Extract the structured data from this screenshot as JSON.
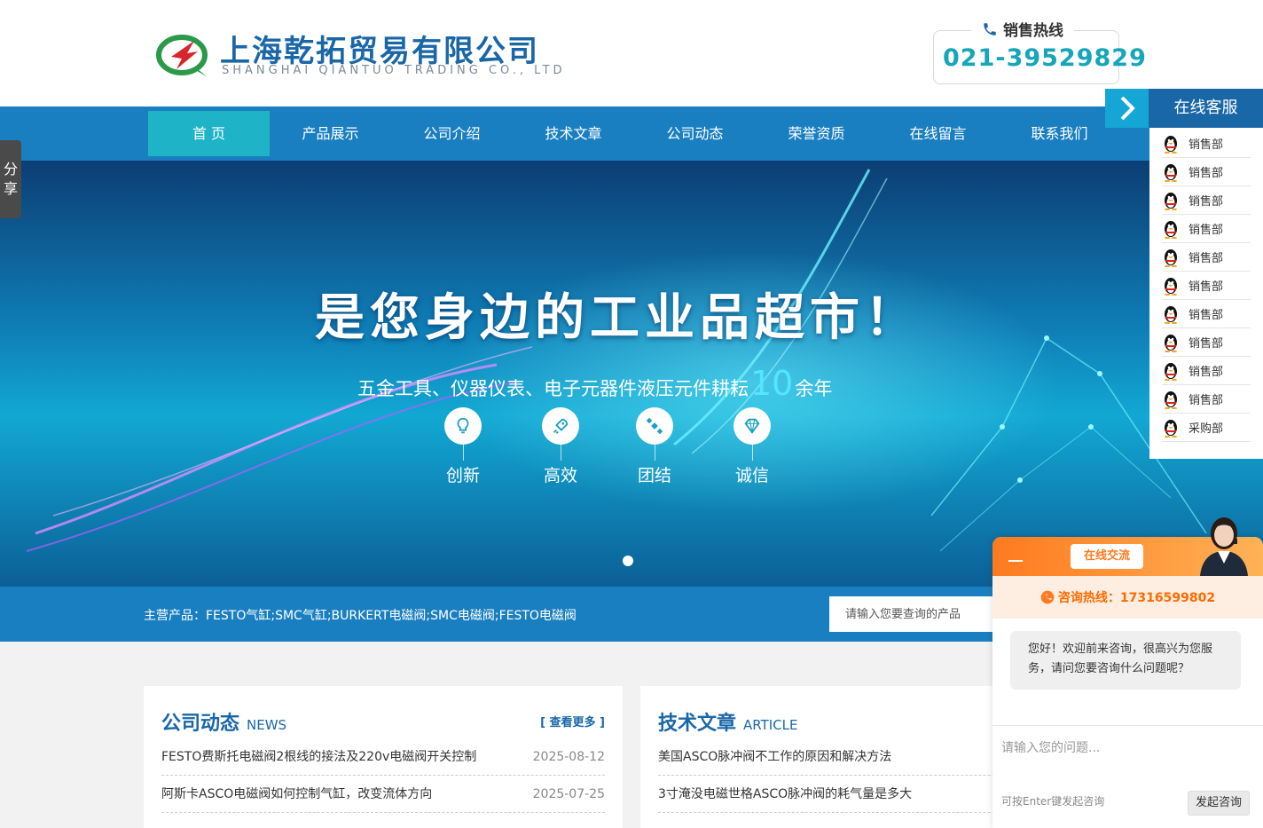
{
  "header": {
    "company_cn": "上海乾拓贸易有限公司",
    "company_en": "SHANGHAI QIANTUO TRADING CO., LTD",
    "hotline_label": "销售热线",
    "hotline_number": "021-39529829"
  },
  "nav": {
    "items": [
      {
        "label": "首 页"
      },
      {
        "label": "产品展示"
      },
      {
        "label": "公司介绍"
      },
      {
        "label": "技术文章"
      },
      {
        "label": "公司动态"
      },
      {
        "label": "荣誉资质"
      },
      {
        "label": "在线留言"
      },
      {
        "label": "联系我们"
      }
    ]
  },
  "banner": {
    "title": "是您身边的工业品超市！",
    "sub_before": "五金工具、仪器仪表、电子元器件液压元件耕耘",
    "sub_highlight": "10",
    "sub_after": "余年",
    "features": [
      {
        "label": "创新",
        "icon": "lightbulb-icon"
      },
      {
        "label": "高效",
        "icon": "rocket-icon"
      },
      {
        "label": "团结",
        "icon": "satellite-icon"
      },
      {
        "label": "诚信",
        "icon": "diamond-icon"
      }
    ]
  },
  "products": {
    "text": "主营产品：FESTO气缸;SMC气缸;BURKERT电磁阀;SMC电磁阀;FESTO电磁阀",
    "search_placeholder": "请输入您要查询的产品"
  },
  "news": {
    "title_cn": "公司动态",
    "title_en": "NEWS",
    "more": "[ 查看更多 ]",
    "items": [
      {
        "title": "FESTO费斯托电磁阀2根线的接法及220v电磁阀开关控制",
        "date": "2025-08-12"
      },
      {
        "title": "阿斯卡ASCO电磁阀如何控制气缸，改变流体方向",
        "date": "2025-07-25"
      }
    ]
  },
  "articles": {
    "title_cn": "技术文章",
    "title_en": "ARTICLE",
    "items": [
      {
        "title": "美国ASCO脉冲阀不工作的原因和解决方法"
      },
      {
        "title": "3寸淹没电磁世格ASCO脉冲阀的耗气量是多大"
      }
    ]
  },
  "share": {
    "label": "分享"
  },
  "service": {
    "title": "在线客服",
    "items": [
      "销售部",
      "销售部",
      "销售部",
      "销售部",
      "销售部",
      "销售部",
      "销售部",
      "销售部",
      "销售部",
      "销售部",
      "采购部"
    ]
  },
  "chat": {
    "tag": "在线交流",
    "hotline": "咨询热线：17316599802",
    "greeting": "您好！欢迎前来咨询，很高兴为您服务，请问您要咨询什么问题呢？",
    "input_placeholder": "请输入您的问题...",
    "hint": "可按Enter键发起咨询",
    "send": "发起咨询"
  },
  "colors": {
    "brand": "#1a67a8",
    "nav": "#1a7fc0",
    "nav_active": "#1fb3c8",
    "hotline": "#16a6b9",
    "chat_accent": "#ff7a1e"
  }
}
